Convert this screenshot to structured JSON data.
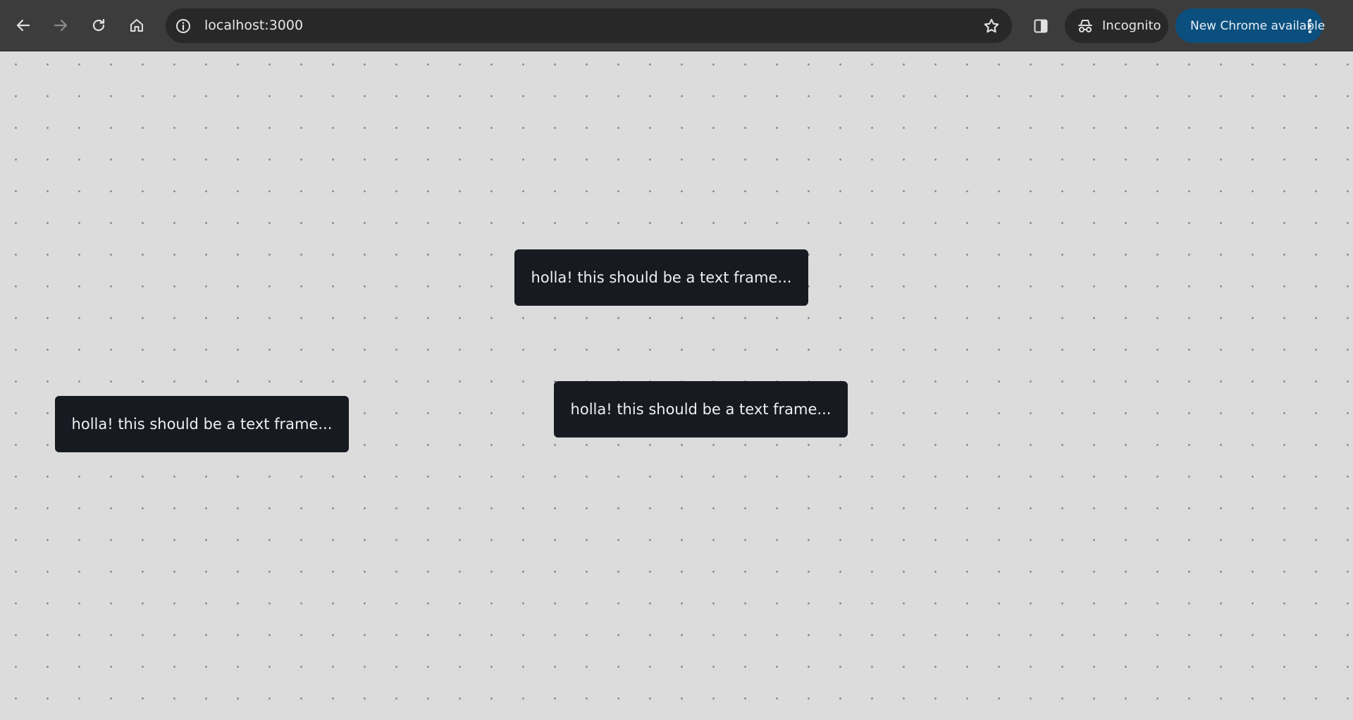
{
  "browser": {
    "back_icon": "arrow-left-icon",
    "forward_icon": "arrow-right-icon",
    "reload_icon": "reload-icon",
    "home_icon": "home-icon",
    "site_info_icon": "info-icon",
    "url": "localhost:3000",
    "bookmark_icon": "star-icon",
    "side_panel_icon": "side-panel-icon",
    "incognito_label": "Incognito",
    "update_label": "New Chrome available",
    "colors": {
      "toolbar": "#3c3c3c",
      "omnibox": "#282828",
      "update_pill": "#0b4f7e"
    }
  },
  "canvas": {
    "background": "#dcdcdc",
    "dot_color": "#8e8e8e",
    "text_frames": [
      {
        "text": "holla! this should be a text frame..."
      },
      {
        "text": "holla! this should be a text frame..."
      },
      {
        "text": "holla! this should be a text frame..."
      }
    ],
    "frame_color": "#181a22"
  }
}
